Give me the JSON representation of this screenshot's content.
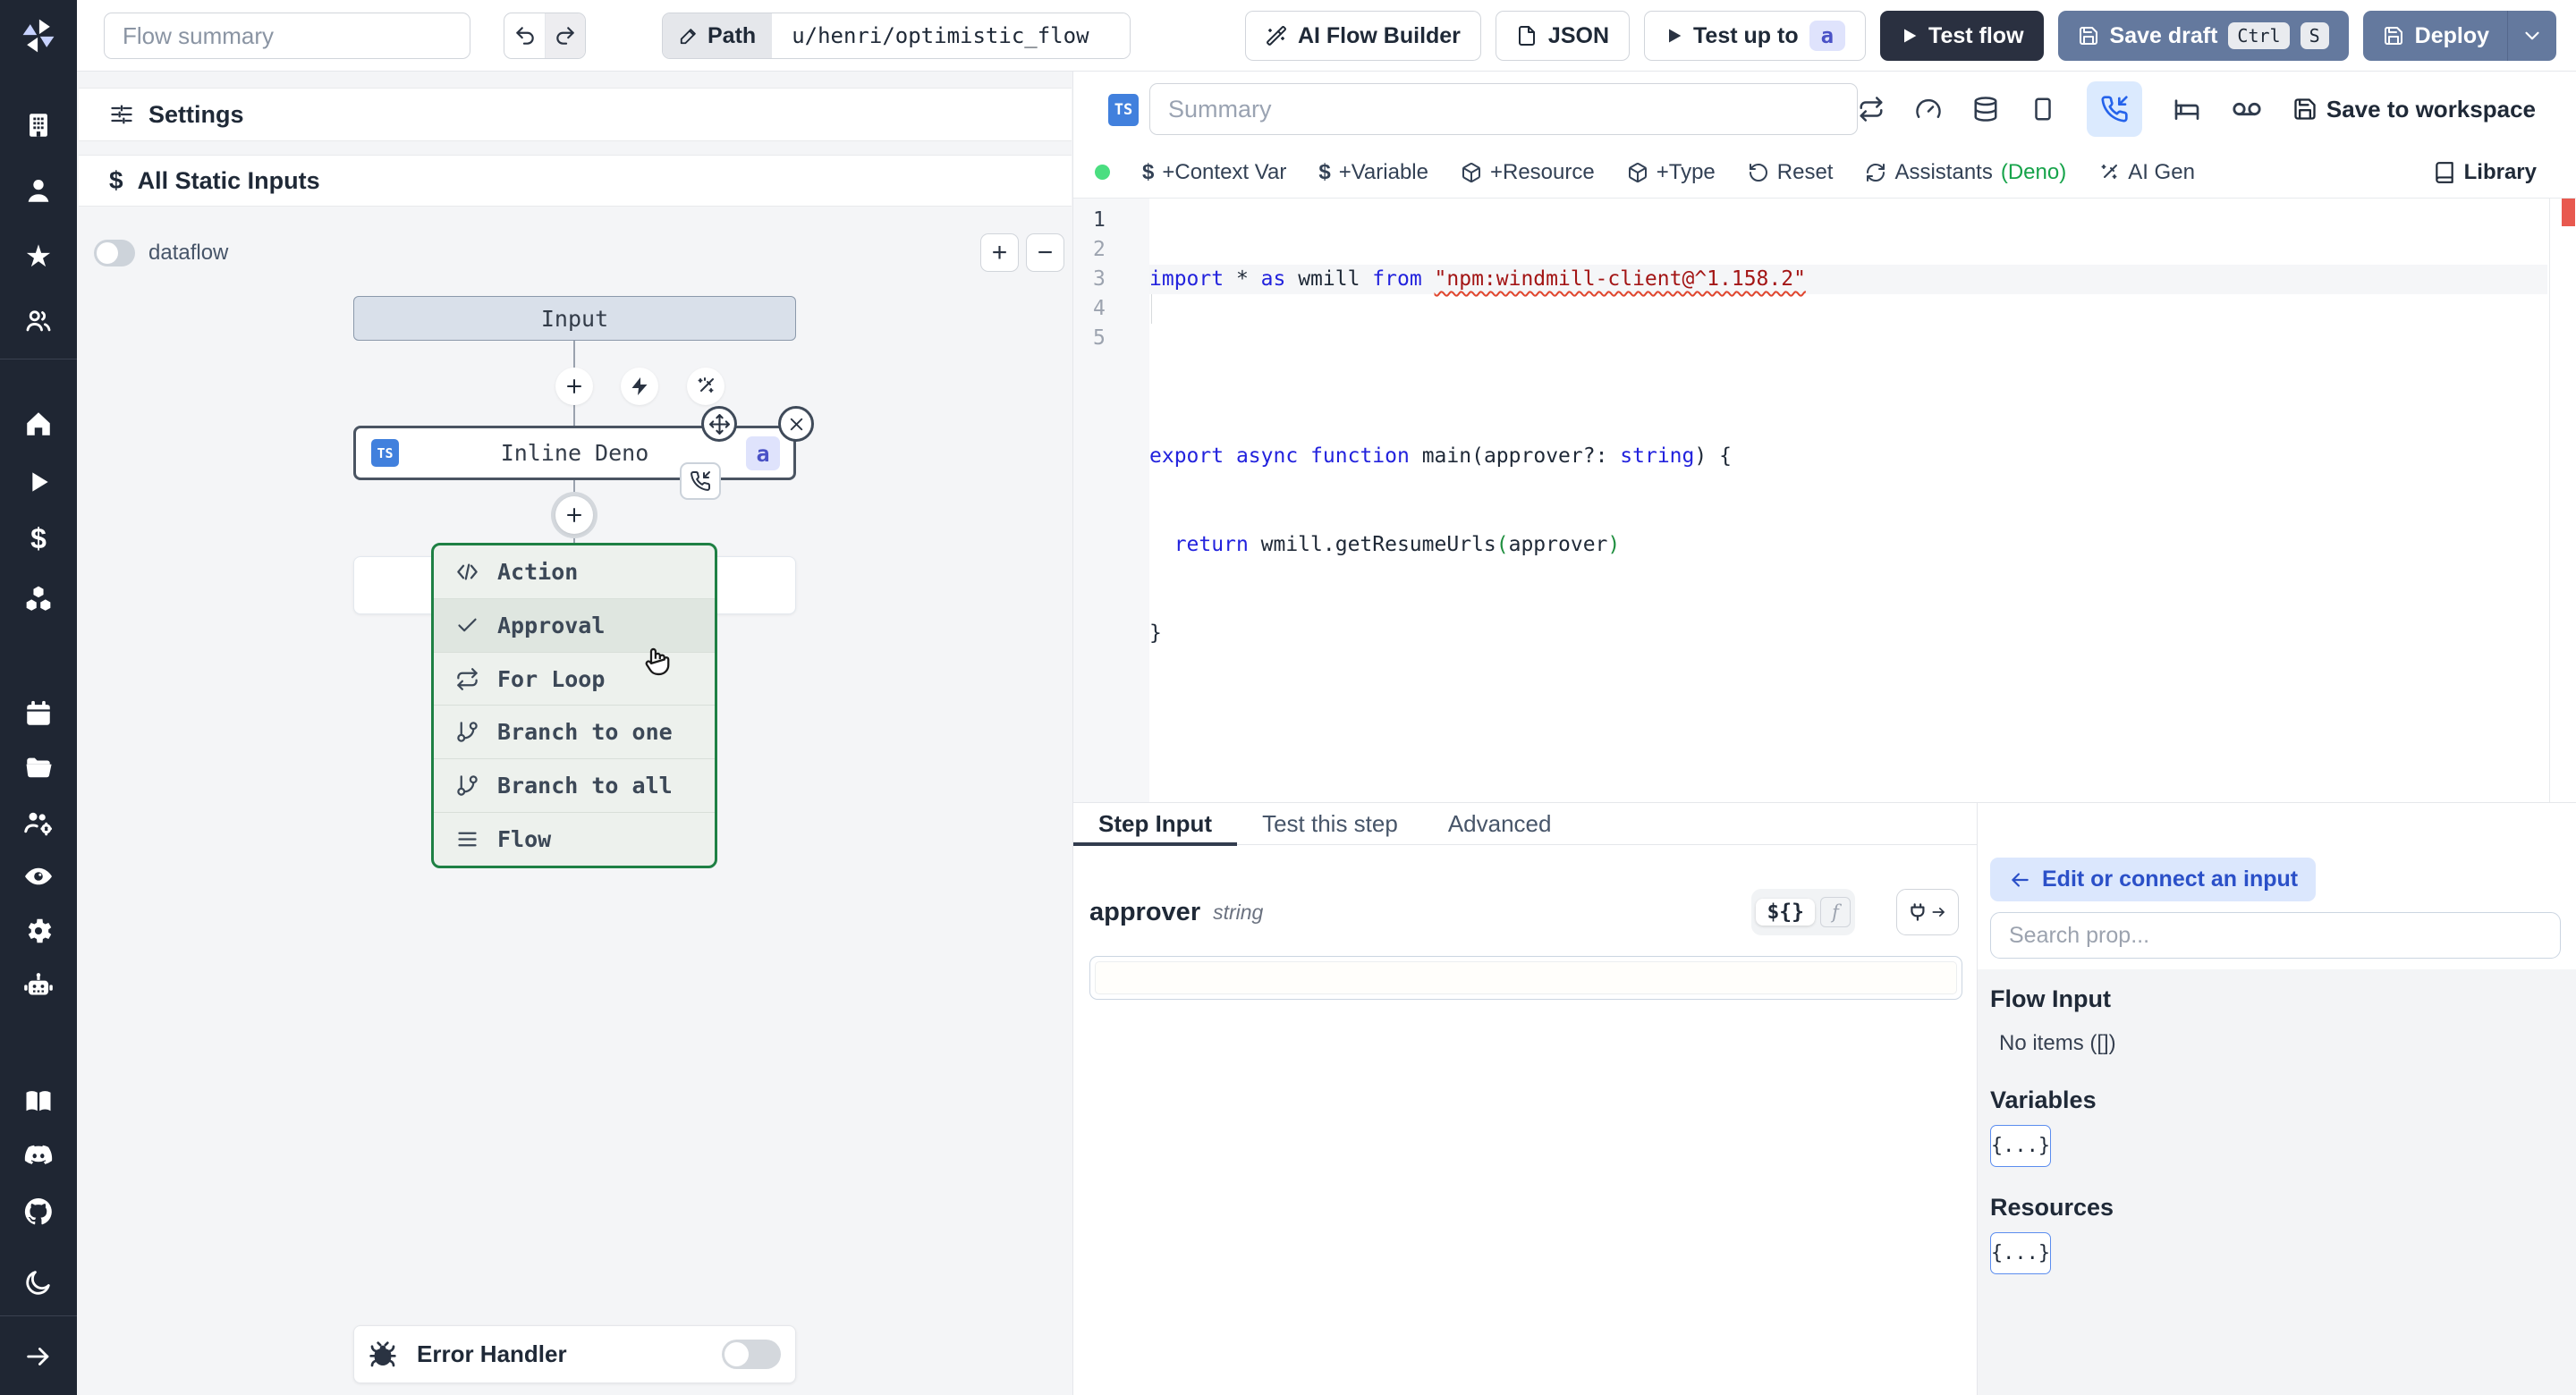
{
  "topbar": {
    "flow_summary_placeholder": "Flow summary",
    "path_label": "Path",
    "path_value": "u/henri/optimistic_flow",
    "ai_flow_builder": "AI Flow Builder",
    "json": "JSON",
    "test_up_to": "Test up to",
    "test_up_to_badge": "a",
    "test_flow": "Test flow",
    "save_draft": "Save draft",
    "kbd_ctrl": "Ctrl",
    "kbd_s": "S",
    "deploy": "Deploy"
  },
  "sidebar": {
    "icons": [
      "building",
      "user",
      "star",
      "users",
      "home",
      "play",
      "dollar",
      "boxes",
      "calendar",
      "folder",
      "user-cog",
      "eye",
      "gear",
      "robot",
      "book",
      "discord",
      "github",
      "moon",
      "arrow-right"
    ],
    "star_glyph": "★",
    "dollar_glyph": "$"
  },
  "flow_panel": {
    "settings": "Settings",
    "all_static_inputs": "All Static Inputs",
    "dataflow": "dataflow",
    "zoom_in": "+",
    "zoom_out": "−",
    "input_node": "Input",
    "inline_node": "Inline Deno",
    "inline_lang": "TS",
    "inline_badge": "a",
    "menu": {
      "items": [
        {
          "label": "Action"
        },
        {
          "label": "Approval"
        },
        {
          "label": "For Loop"
        },
        {
          "label": "Branch to one"
        },
        {
          "label": "Branch to all"
        },
        {
          "label": "Flow"
        }
      ]
    },
    "error_handler": "Error Handler"
  },
  "editor": {
    "lang_badge": "TS",
    "summary_placeholder": "Summary",
    "save_to_workspace": "Save to workspace",
    "toolbar": {
      "context_var_sign": "$",
      "context_var": "+Context Var",
      "variable_sign": "$",
      "variable": "+Variable",
      "resource": "+Resource",
      "type": "+Type",
      "reset": "Reset",
      "assistants": "Assistants",
      "assistants_lang": "(Deno)",
      "ai_gen": "AI Gen",
      "library": "Library"
    },
    "code": {
      "line_numbers": [
        "1",
        "2",
        "3",
        "4",
        "5"
      ],
      "lines": [
        [
          "import",
          " * ",
          "as",
          " wmill ",
          "from",
          " ",
          "\"npm:windmill-client@^1.158.2\""
        ],
        [
          ""
        ],
        [
          "export",
          " ",
          "async",
          " ",
          "function",
          " main",
          "(",
          "approver",
          "?: ",
          "string",
          ")",
          " {"
        ],
        [
          "  ",
          "return",
          " wmill.getResumeUrls",
          "(",
          "approver",
          ")"
        ],
        [
          "}"
        ]
      ]
    }
  },
  "step_panel": {
    "tabs": [
      "Step Input",
      "Test this step",
      "Advanced"
    ],
    "field_name": "approver",
    "field_type": "string",
    "expr_btn": "${}",
    "fn_btn": "f",
    "input_value": ""
  },
  "connect_panel": {
    "back": "Edit or connect an input",
    "search_placeholder": "Search prop...",
    "flow_input_title": "Flow Input",
    "flow_input_empty": "No items ([])",
    "variables_title": "Variables",
    "variables_btn": "{...}",
    "resources_title": "Resources",
    "resources_btn": "{...}"
  },
  "colors": {
    "sidebar_bg": "#1f2633",
    "accent_blue": "#2563eb",
    "slate_button": "#64799e",
    "dark_button": "#2a3040",
    "ts_badge_blue": "#4180dd",
    "menu_border_green": "#1e8044",
    "deno_green": "#16a34a",
    "status_green": "#4ade80",
    "error_marker_red": "#e8594f",
    "badge_indigo_bg": "#dfe3fc",
    "badge_indigo_text": "#4a52c6"
  }
}
